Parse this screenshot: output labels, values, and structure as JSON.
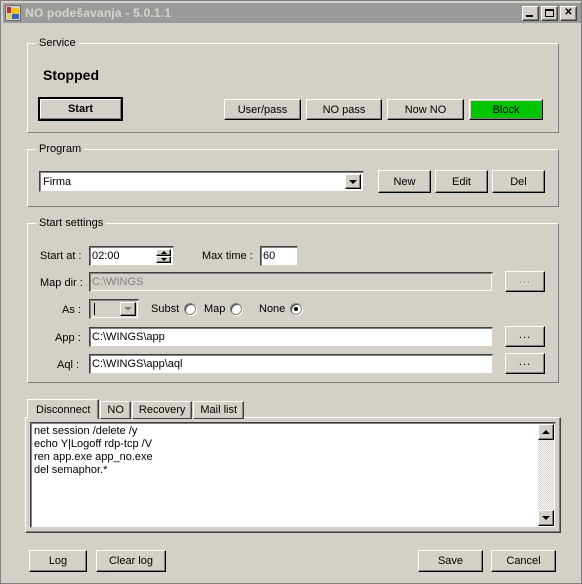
{
  "window": {
    "title": "NO podešavanja - 5.0.1.1",
    "icon": "app-icon",
    "minimize_label": "",
    "maximize_label": "",
    "close_label": "✕"
  },
  "service": {
    "group_title": "Service",
    "status": "Stopped",
    "start_button": "Start",
    "user_pass_button": "User/pass",
    "no_pass_button": "NO pass",
    "now_no_button": "Now NO",
    "block_button": "Block",
    "block_color": "#00c400"
  },
  "program": {
    "group_title": "Program",
    "selected": "Firma",
    "new_button": "New",
    "edit_button": "Edit",
    "del_button": "Del"
  },
  "start_settings": {
    "group_title": "Start settings",
    "start_at_label": "Start at :",
    "start_at_value": "02:00",
    "max_time_label": "Max time :",
    "max_time_value": "60",
    "map_dir_label": "Map dir :",
    "map_dir_value": "C:\\WINGS",
    "map_dir_browse": "...",
    "as_label": "As :",
    "as_value": "",
    "radio_subst": "Subst",
    "radio_map": "Map",
    "radio_none": "None",
    "selected_radio": "None",
    "app_label": "App :",
    "app_value": "C:\\WINGS\\app",
    "app_browse": "...",
    "aql_label": "Aql :",
    "aql_value": "C:\\WINGS\\app\\aql",
    "aql_browse": "..."
  },
  "tabs": {
    "items": [
      {
        "label": "Disconnect",
        "active": true
      },
      {
        "label": "NO",
        "active": false
      },
      {
        "label": "Recovery",
        "active": false
      },
      {
        "label": "Mail list",
        "active": false
      }
    ],
    "script_text": "net session /delete /y\necho Y|Logoff rdp-tcp /V\nren app.exe app_no.exe\ndel semaphor.*"
  },
  "footer": {
    "log_button": "Log",
    "clear_log_button": "Clear log",
    "save_button": "Save",
    "cancel_button": "Cancel"
  }
}
